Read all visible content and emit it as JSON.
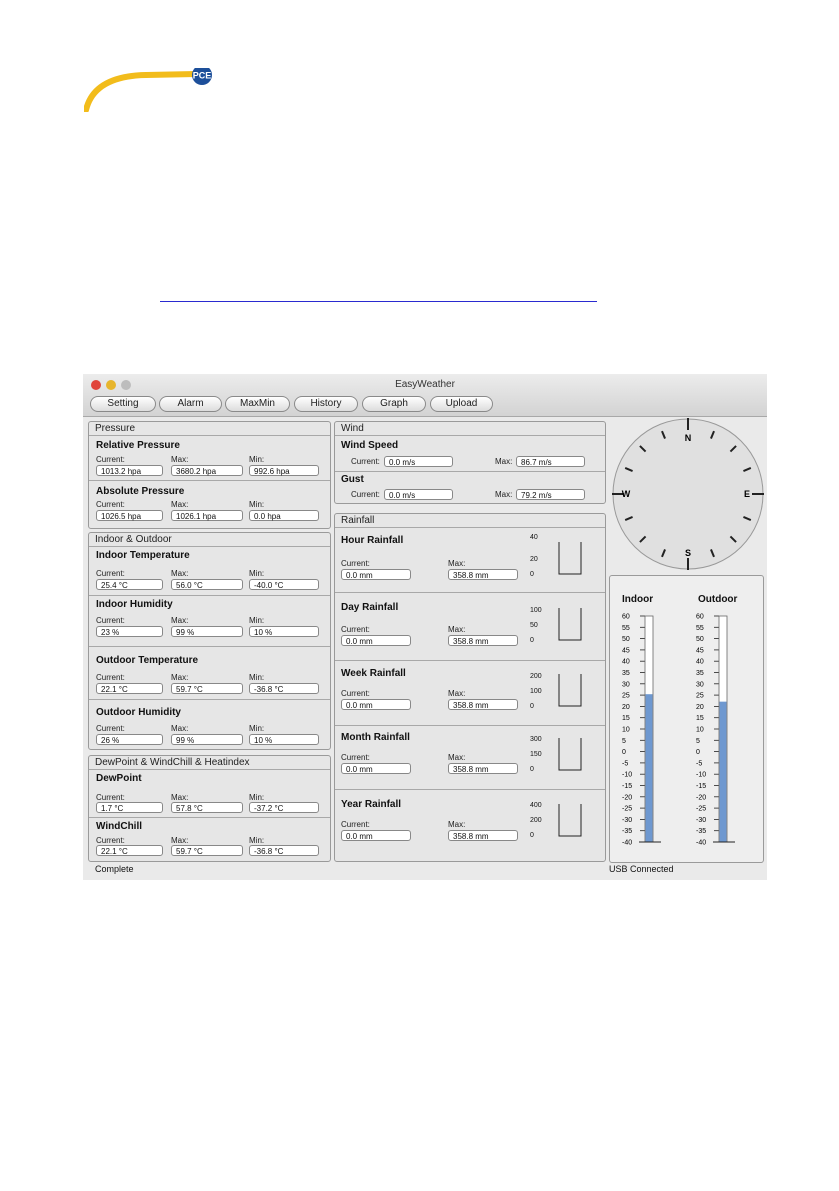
{
  "window_title": "EasyWeather",
  "toolbar": [
    "Setting",
    "Alarm",
    "MaxMin",
    "History",
    "Graph",
    "Upload"
  ],
  "labels": {
    "current": "Current:",
    "max": "Max:",
    "min": "Min:"
  },
  "pressure": {
    "title": "Pressure",
    "relative": {
      "name": "Relative Pressure",
      "current": "1013.2 hpa",
      "max": "3680.2 hpa",
      "min": "992.6 hpa"
    },
    "absolute": {
      "name": "Absolute Pressure",
      "current": "1026.5 hpa",
      "max": "1026.1 hpa",
      "min": "0.0 hpa"
    }
  },
  "indoor_outdoor": {
    "title": "Indoor & Outdoor",
    "rows": [
      {
        "name": "Indoor Temperature",
        "current": "25.4 °C",
        "max": "56.0 °C",
        "min": "-40.0 °C"
      },
      {
        "name": "Indoor Humidity",
        "current": "23 %",
        "max": "99 %",
        "min": "10 %"
      },
      {
        "name": "Outdoor Temperature",
        "current": "22.1 °C",
        "max": "59.7 °C",
        "min": "-36.8 °C"
      },
      {
        "name": "Outdoor Humidity",
        "current": "26 %",
        "max": "99 %",
        "min": "10 %"
      }
    ]
  },
  "dewpoint": {
    "title": "DewPoint & WindChill & Heatindex",
    "rows": [
      {
        "name": "DewPoint",
        "current": "1.7 °C",
        "max": "57.8 °C",
        "min": "-37.2 °C"
      },
      {
        "name": "WindChill",
        "current": "22.1 °C",
        "max": "59.7 °C",
        "min": "-36.8 °C"
      }
    ]
  },
  "wind": {
    "title": "Wind",
    "speed": {
      "name": "Wind Speed",
      "current": "0.0 m/s",
      "max": "86.7 m/s"
    },
    "gust": {
      "name": "Gust",
      "current": "0.0 m/s",
      "max": "79.2 m/s"
    }
  },
  "rainfall": {
    "title": "Rainfall",
    "rows": [
      {
        "name": "Hour Rainfall",
        "current": "0.0 mm",
        "max": "358.8 mm",
        "scale": [
          "40",
          "20",
          "0"
        ]
      },
      {
        "name": "Day Rainfall",
        "current": "0.0 mm",
        "max": "358.8 mm",
        "scale": [
          "100",
          "50",
          "0"
        ]
      },
      {
        "name": "Week Rainfall",
        "current": "0.0 mm",
        "max": "358.8 mm",
        "scale": [
          "200",
          "100",
          "0"
        ]
      },
      {
        "name": "Month Rainfall",
        "current": "0.0 mm",
        "max": "358.8 mm",
        "scale": [
          "300",
          "150",
          "0"
        ]
      },
      {
        "name": "Year Rainfall",
        "current": "0.0 mm",
        "max": "358.8 mm",
        "scale": [
          "400",
          "200",
          "0"
        ]
      }
    ]
  },
  "compass": {
    "n": "N",
    "e": "E",
    "s": "S",
    "w": "W"
  },
  "thermometers": {
    "indoor_label": "Indoor",
    "outdoor_label": "Outdoor",
    "scale": [
      "60",
      "55",
      "50",
      "45",
      "40",
      "35",
      "30",
      "25",
      "20",
      "15",
      "10",
      "5",
      "0",
      "-5",
      "-10",
      "-15",
      "-20",
      "-25",
      "-30",
      "-35",
      "-40"
    ],
    "indoor_value": 25.4,
    "outdoor_value": 22.1,
    "fill_color": "#6e98d0"
  },
  "status": {
    "left": "Complete",
    "right": "USB Connected"
  },
  "colors": {
    "close": "#e0443a",
    "minimize": "#e7b52d",
    "zoom": "#bdbdbd",
    "link": "#2a2ad0",
    "logo": "#f2bc1b"
  }
}
